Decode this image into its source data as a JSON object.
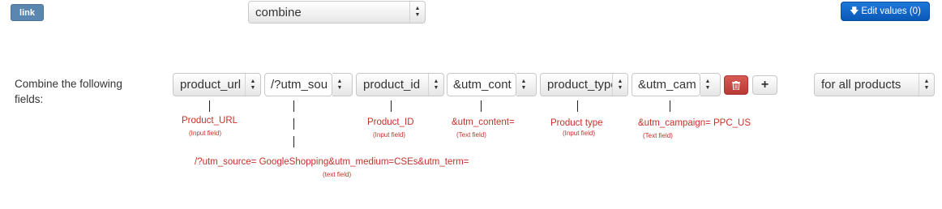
{
  "toolbar": {
    "link_label": "link",
    "mode_select": "combine",
    "edit_values_label": "Edit values (0)",
    "edit_icon": "arrow-down-icon"
  },
  "rule": {
    "label": "Combine the following fields:",
    "fields": [
      {
        "value": "product_url",
        "kind": "select"
      },
      {
        "value": "/?utm_sou",
        "kind": "text"
      },
      {
        "value": "product_id",
        "kind": "select"
      },
      {
        "value": "&utm_cont",
        "kind": "text"
      },
      {
        "value": "product_typе",
        "kind": "select"
      },
      {
        "value": "&utm_cam",
        "kind": "text"
      }
    ],
    "delete_icon": "trash-icon",
    "add_label": "+",
    "scope_select": "for all products"
  },
  "annotations": [
    {
      "text": "Product_URL",
      "sub": "(Input field)"
    },
    {
      "text": "/?utm_source= GoogleShopping&utm_medium=CSEs&utm_term=",
      "sub": "(text field)"
    },
    {
      "text": "Product_ID",
      "sub": "(Input field)"
    },
    {
      "text": "&utm_content=",
      "sub": "(Text field)"
    },
    {
      "text": "Product type",
      "sub": "(Input field)"
    },
    {
      "text": "&utm_campaign= PPC_US",
      "sub": "(Text field)"
    }
  ],
  "colors": {
    "annotation": "#c8302a",
    "primary_button": "#1467c8",
    "danger_button": "#c8463f",
    "link_button": "#5b86b0"
  }
}
